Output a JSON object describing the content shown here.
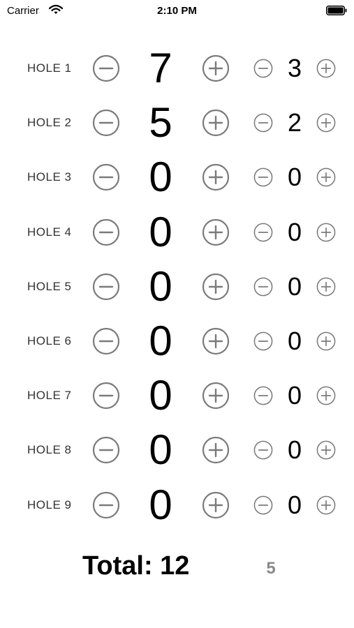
{
  "status_bar": {
    "carrier": "Carrier",
    "time": "2:10 PM"
  },
  "holes": [
    {
      "label": "HOLE 1",
      "score": "7",
      "putts": "3"
    },
    {
      "label": "HOLE 2",
      "score": "5",
      "putts": "2"
    },
    {
      "label": "HOLE 3",
      "score": "0",
      "putts": "0"
    },
    {
      "label": "HOLE 4",
      "score": "0",
      "putts": "0"
    },
    {
      "label": "HOLE 5",
      "score": "0",
      "putts": "0"
    },
    {
      "label": "HOLE 6",
      "score": "0",
      "putts": "0"
    },
    {
      "label": "HOLE 7",
      "score": "0",
      "putts": "0"
    },
    {
      "label": "HOLE 8",
      "score": "0",
      "putts": "0"
    },
    {
      "label": "HOLE 9",
      "score": "0",
      "putts": "0"
    }
  ],
  "totals": {
    "total_label": "Total: 12",
    "putts_total": "5"
  },
  "colors": {
    "button_stroke": "#7a7a7a",
    "text": "#000000",
    "secondary_text": "#8a8a8a"
  },
  "icons": {
    "decrement": "minus-circle-icon",
    "increment": "plus-circle-icon",
    "wifi": "wifi-icon",
    "battery": "battery-icon"
  }
}
